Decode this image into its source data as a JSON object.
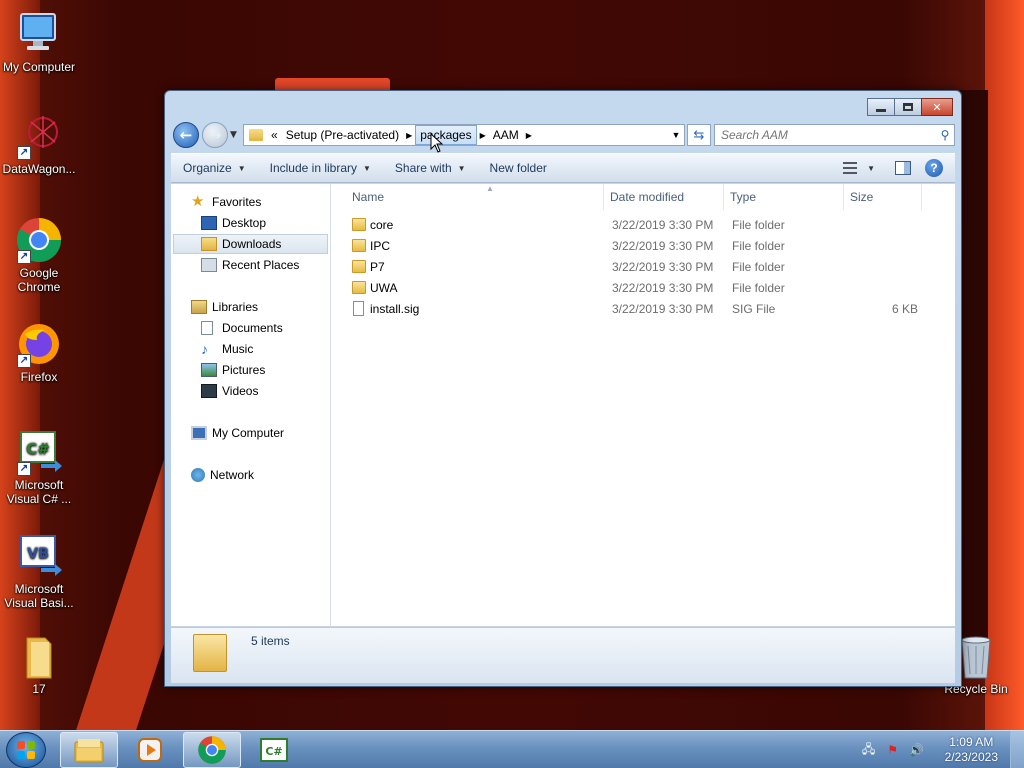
{
  "desktop": {
    "icons": [
      {
        "label": "My Computer"
      },
      {
        "label": "DataWagon..."
      },
      {
        "label": "Google Chrome"
      },
      {
        "label": "Firefox"
      },
      {
        "label": "Microsoft Visual C# ..."
      },
      {
        "label": "Microsoft Visual Basi..."
      },
      {
        "label": "17"
      },
      {
        "label": "Recycle Bin"
      }
    ]
  },
  "window": {
    "breadcrumb": {
      "overflow": "«",
      "items": [
        "Setup (Pre-activated)",
        "packages",
        "AAM"
      ]
    },
    "search": {
      "placeholder": "Search AAM"
    },
    "toolbar": {
      "organize": "Organize",
      "include_in_library": "Include in library",
      "share_with": "Share with",
      "new_folder": "New folder"
    },
    "navpane": {
      "favorites": "Favorites",
      "desktop": "Desktop",
      "downloads": "Downloads",
      "recent_places": "Recent Places",
      "libraries": "Libraries",
      "documents": "Documents",
      "music": "Music",
      "pictures": "Pictures",
      "videos": "Videos",
      "my_computer": "My Computer",
      "network": "Network"
    },
    "columns": {
      "name": "Name",
      "date": "Date modified",
      "type": "Type",
      "size": "Size"
    },
    "files": [
      {
        "name": "core",
        "date": "3/22/2019 3:30 PM",
        "type": "File folder",
        "size": "",
        "kind": "folder"
      },
      {
        "name": "IPC",
        "date": "3/22/2019 3:30 PM",
        "type": "File folder",
        "size": "",
        "kind": "folder"
      },
      {
        "name": "P7",
        "date": "3/22/2019 3:30 PM",
        "type": "File folder",
        "size": "",
        "kind": "folder"
      },
      {
        "name": "UWA",
        "date": "3/22/2019 3:30 PM",
        "type": "File folder",
        "size": "",
        "kind": "folder"
      },
      {
        "name": "install.sig",
        "date": "3/22/2019 3:30 PM",
        "type": "SIG File",
        "size": "6 KB",
        "kind": "file"
      }
    ],
    "details": {
      "count": "5 items"
    }
  },
  "taskbar": {
    "clock_time": "1:09 AM",
    "clock_date": "2/23/2023"
  },
  "colors": {
    "accent": "#1f5fb4",
    "taskbar": "#6a91bf",
    "folder": "#e8bb43"
  }
}
